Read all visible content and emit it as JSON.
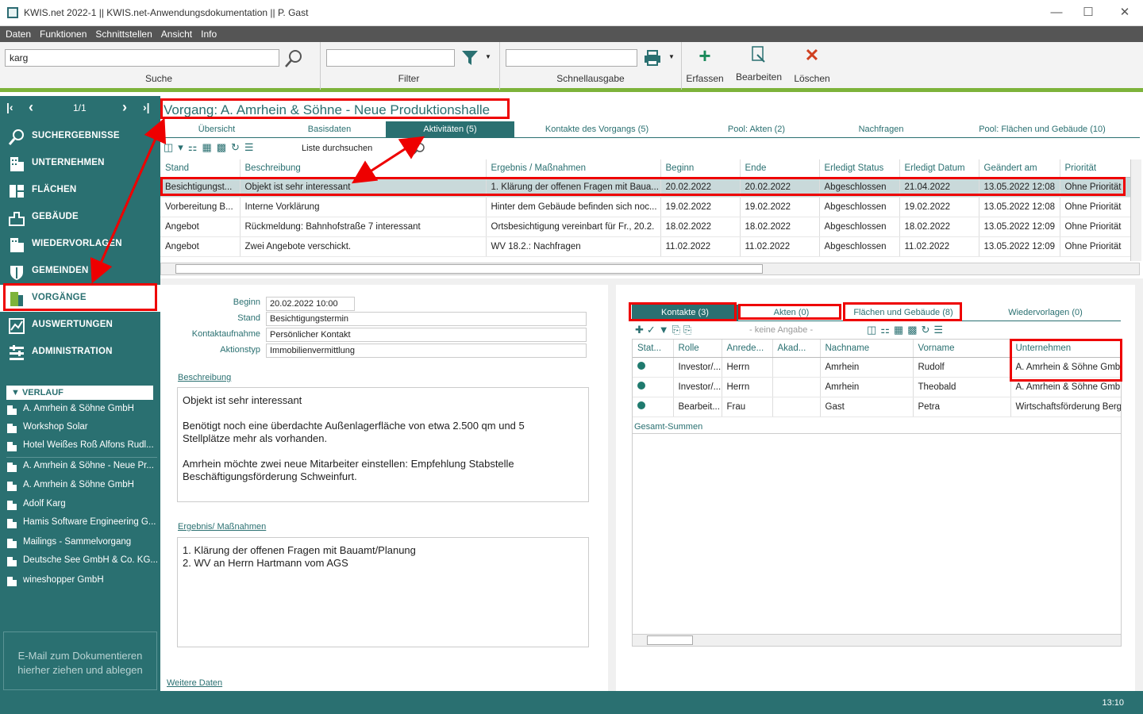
{
  "window": {
    "title": "KWIS.net 2022-1 || KWIS.net-Anwendungsdokumentation || P. Gast"
  },
  "menu": [
    "Daten",
    "Funktionen",
    "Schnittstellen",
    "Ansicht",
    "Info"
  ],
  "toolbar": {
    "search_value": "karg",
    "search_label": "Suche",
    "filter_label": "Filter",
    "schnell_label": "Schnellausgabe",
    "erfassen": "Erfassen",
    "bearbeiten": "Bearbeiten",
    "loeschen": "Löschen"
  },
  "sidebar": {
    "pager": "1/1",
    "nav": [
      {
        "label": "SUCHERGEBNISSE",
        "icon": "search-icon"
      },
      {
        "label": "UNTERNEHMEN",
        "icon": "building-icon"
      },
      {
        "label": "FLÄCHEN",
        "icon": "area-icon"
      },
      {
        "label": "GEBÄUDE",
        "icon": "building-icon"
      },
      {
        "label": "WIEDERVORLAGEN",
        "icon": "building-icon"
      },
      {
        "label": "GEMEINDEN",
        "icon": "shield-icon"
      },
      {
        "label": "VORGÄNGE",
        "icon": "process-icon"
      },
      {
        "label": "AUSWERTUNGEN",
        "icon": "chart-icon"
      },
      {
        "label": "ADMINISTRATION",
        "icon": "admin-icon"
      }
    ],
    "verlauf_title": "VERLAUF",
    "history": [
      "A. Amrhein & Söhne GmbH",
      "Workshop Solar",
      "Hotel Weißes Roß Alfons Rudl...",
      "A. Amrhein & Söhne - Neue Pr...",
      "A. Amrhein & Söhne GmbH",
      "Adolf Karg",
      "Hamis Software Engineering G...",
      "Mailings - Sammelvorgang",
      "Deutsche See GmbH & Co. KG...",
      "wineshopper GmbH"
    ],
    "drop_hint_1": "E-Mail  zum Dokumentieren",
    "drop_hint_2": "hierher ziehen und ablegen"
  },
  "main": {
    "title": "Vorgang: A. Amrhein & Söhne - Neue Produktionshalle",
    "tabs": [
      "Übersicht",
      "Basisdaten",
      "Aktivitäten (5)",
      "Kontakte des Vorgangs (5)",
      "Pool: Akten (2)",
      "Nachfragen",
      "Pool: Flächen und Gebäude (10)"
    ],
    "list_search": "Liste durchsuchen",
    "activities": {
      "columns": [
        "Stand",
        "Beschreibung",
        "Ergebnis / Maßnahmen",
        "Beginn",
        "Ende",
        "Erledigt Status",
        "Erledigt Datum",
        "Geändert am",
        "Priorität"
      ],
      "rows": [
        [
          "Besichtigungst...",
          "Objekt ist sehr interessant",
          "1. Klärung der offenen Fragen mit Baua...",
          "20.02.2022",
          "20.02.2022",
          "Abgeschlossen",
          "21.04.2022",
          "13.05.2022 12:08",
          "Ohne Priorität"
        ],
        [
          "Vorbereitung  B...",
          "Interne Vorklärung",
          "Hinter dem Gebäude befinden sich noc...",
          "19.02.2022",
          "19.02.2022",
          "Abgeschlossen",
          "19.02.2022",
          "13.05.2022 12:08",
          "Ohne Priorität"
        ],
        [
          "Angebot",
          "Rückmeldung: Bahnhofstraße 7 interessant",
          "Ortsbesichtigung vereinbart für Fr., 20.2.",
          "18.02.2022",
          "18.02.2022",
          "Abgeschlossen",
          "18.02.2022",
          "13.05.2022 12:09",
          "Ohne Priorität"
        ],
        [
          "Angebot",
          "Zwei Angebote verschickt.",
          "WV 18.2.: Nachfragen",
          "11.02.2022",
          "11.02.2022",
          "Abgeschlossen",
          "11.02.2022",
          "13.05.2022 12:09",
          "Ohne Priorität"
        ]
      ]
    },
    "detail": {
      "beginn_label": "Beginn",
      "beginn": "20.02.2022 10:00",
      "stand_label": "Stand",
      "stand": "Besichtigungstermin",
      "kontakt_label": "Kontaktaufnahme",
      "kontakt": "Persönlicher Kontakt",
      "typ_label": "Aktionstyp",
      "typ": "Immobilienvermittlung",
      "beschreibung_label": "Beschreibung",
      "beschreibung": "Objekt ist sehr interessant\n\nBenötigt noch eine überdachte Außenlagerfläche von etwa 2.500 qm und 5\nStellplätze mehr als vorhanden.\n\nAmrhein möchte zwei neue Mitarbeiter einstellen: Empfehlung Stabstelle\nBeschäftigungsförderung Schweinfurt.",
      "ergebnis_label": "Ergebnis/ Maßnahmen",
      "ergebnis": "1. Klärung der offenen Fragen mit Bauamt/Planung\n2. WV an Herrn Hartmann vom AGS",
      "weitere": "Weitere Daten"
    },
    "contacts": {
      "tabs": [
        "Kontakte (3)",
        "Akten (0)",
        "Flächen und Gebäude (8)",
        "Wiedervorlagen (0)"
      ],
      "keine_angabe": "- keine Angabe -",
      "columns": [
        "Stat...",
        "Rolle",
        "Anrede...",
        "Akad...",
        "Nachname",
        "Vorname",
        "Unternehmen"
      ],
      "rows": [
        [
          "",
          "Investor/...",
          "Herrn",
          "",
          "Amrhein",
          "Rudolf",
          "A. Amrhein & Söhne GmbH"
        ],
        [
          "",
          "Investor/...",
          "Herrn",
          "",
          "Amrhein",
          "Theobald",
          "A. Amrhein & Söhne GmbH"
        ],
        [
          "",
          "Bearbeit...",
          "Frau",
          "",
          "Gast",
          "Petra",
          "Wirtschaftsförderung  Bergr"
        ]
      ],
      "gesamt": "Gesamt-Summen"
    }
  },
  "status": {
    "time": "13:10"
  },
  "colors": {
    "accent": "#2a7071",
    "highlight": "#e00000",
    "green": "#7db33a"
  }
}
